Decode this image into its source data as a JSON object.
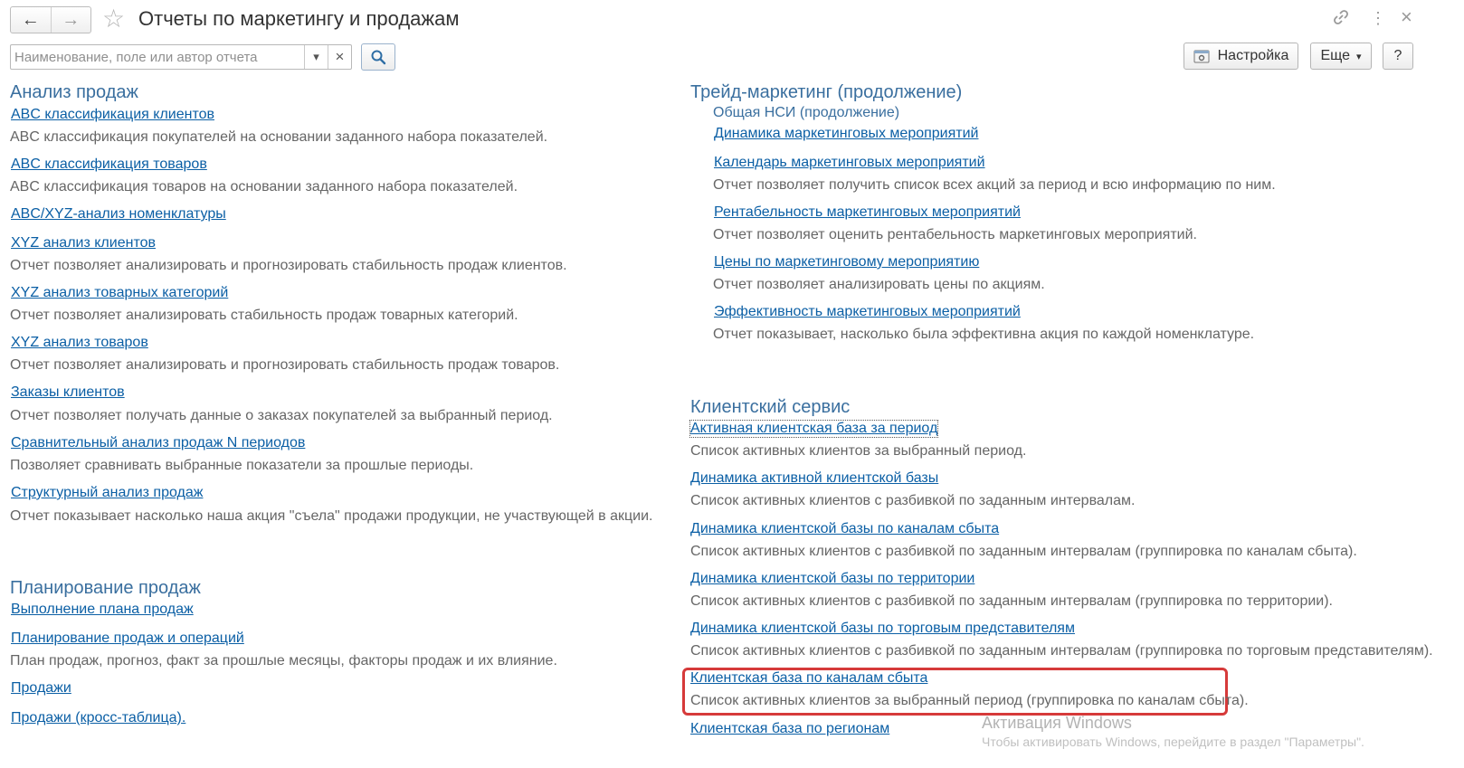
{
  "header": {
    "back_glyph": "←",
    "forward_glyph": "→",
    "star_glyph": "☆",
    "title": "Отчеты по маркетингу и продажам",
    "link_glyph": "🔗",
    "more_glyph": "⋮",
    "close_glyph": "×"
  },
  "toolbar": {
    "search_placeholder": "Наименование, поле или автор отчета",
    "dropdown_glyph": "▾",
    "clear_glyph": "×",
    "settings_label": "Настройка",
    "more_label": "Еще",
    "more_arrow": "▾",
    "help_label": "?"
  },
  "left": {
    "sales_analysis": {
      "title": "Анализ продаж",
      "items": [
        {
          "link": "ABC классификация клиентов",
          "desc": "ABC классификация покупателей на основании заданного набора показателей."
        },
        {
          "link": "ABC классификация товаров",
          "desc": "ABC классификация товаров на основании заданного набора показателей."
        },
        {
          "link": "ABC/XYZ-анализ номенклатуры",
          "desc": ""
        },
        {
          "link": "XYZ анализ клиентов",
          "desc": "Отчет позволяет анализировать и прогнозировать стабильность продаж клиентов."
        },
        {
          "link": "XYZ анализ товарных категорий",
          "desc": "Отчет позволяет анализировать стабильность продаж товарных категорий."
        },
        {
          "link": "XYZ анализ товаров",
          "desc": "Отчет позволяет анализировать и прогнозировать стабильность продаж товаров."
        },
        {
          "link": "Заказы клиентов",
          "desc": "Отчет позволяет получать данные о заказах покупателей за выбранный период."
        },
        {
          "link": "Сравнительный анализ продаж N периодов",
          "desc": "Позволяет сравнивать выбранные показатели за прошлые периоды."
        },
        {
          "link": "Структурный анализ продаж",
          "desc": "Отчет показывает насколько наша акция \"съела\" продажи продукции, не участвующей в акции."
        }
      ]
    },
    "sales_planning": {
      "title": "Планирование продаж",
      "items": [
        {
          "link": "Выполнение плана продаж",
          "desc": ""
        },
        {
          "link": "Планирование продаж и операций",
          "desc": "План продаж, прогноз, факт за прошлые месяцы, факторы продаж и их влияние."
        },
        {
          "link": "Продажи",
          "desc": ""
        },
        {
          "link": "Продажи (кросс-таблица).",
          "desc": ""
        }
      ]
    }
  },
  "right": {
    "trade_marketing": {
      "title": "Трейд-маркетинг (продолжение)",
      "subtitle": "Общая НСИ (продолжение)",
      "items": [
        {
          "link": "Динамика маркетинговых мероприятий",
          "desc": ""
        },
        {
          "link": "Календарь маркетинговых мероприятий",
          "desc": "Отчет позволяет получить список всех акций за период и всю информацию по ним."
        },
        {
          "link": "Рентабельность маркетинговых мероприятий",
          "desc": "Отчет позволяет оценить рентабельность маркетинговых мероприятий."
        },
        {
          "link": "Цены по маркетинговому мероприятию",
          "desc": "Отчет позволяет анализировать цены по акциям."
        },
        {
          "link": "Эффективность маркетинговых мероприятий",
          "desc": "Отчет показывает, насколько была эффективна акция по каждой номенклатуре."
        }
      ]
    },
    "client_service": {
      "title": "Клиентский сервис",
      "items": [
        {
          "link": "Активная клиентская база за период",
          "desc": "Список активных клиентов за выбранный период."
        },
        {
          "link": "Динамика активной клиентской базы",
          "desc": "Список активных клиентов с разбивкой по заданным интервалам."
        },
        {
          "link": "Динамика клиентской базы по каналам сбыта",
          "desc": "Список активных клиентов с разбивкой по заданным интервалам (группировка по каналам сбыта)."
        },
        {
          "link": "Динамика клиентской базы по территории",
          "desc": "Список активных клиентов с разбивкой по заданным интервалам (группировка по территории)."
        },
        {
          "link": "Динамика клиентской базы по торговым представителям",
          "desc": "Список активных клиентов с разбивкой по заданным интервалам (группировка по торговым представителям)."
        },
        {
          "link": "Клиентская база по каналам сбыта",
          "desc": "Список активных клиентов за выбранный период (группировка по каналам сбыта)."
        },
        {
          "link": "Клиентская база по регионам",
          "desc": ""
        }
      ]
    }
  },
  "watermark": {
    "line1": "Активация Windows",
    "line2": "Чтобы активировать Windows, перейдите в раздел \"Параметры\"."
  },
  "colors": {
    "section_title": "#3a6f9f",
    "link": "#0b5fa5",
    "description": "#666666",
    "highlight_border": "#d63a3a"
  }
}
